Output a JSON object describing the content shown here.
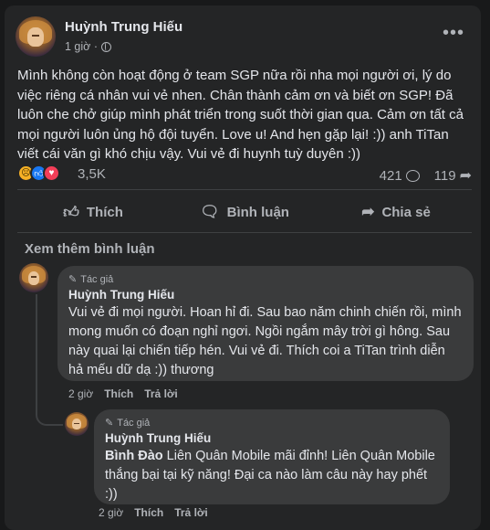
{
  "post": {
    "author": "Huỳnh Trung Hiếu",
    "time": "1 giờ ·",
    "more": "•••",
    "text": "Mình không còn hoạt động ở team SGP nữa rồi nha mọi người ơi, lý do việc riêng cá nhân vui vẻ nhen. Chân thành cảm ơn và biết ơn SGP! Đã luôn che chở giúp mình phát triển trong suốt thời gian qua. Cảm ơn tất cả mọi người luôn ủng hộ đội tuyển. Love u! And hẹn gặp lại! :)) anh TiTan viết cái văn gì khó chịu vậy. Vui vẻ đi huynh tuỳ duyên :))"
  },
  "reactions": {
    "icons": [
      "sad-emoji",
      "like",
      "love"
    ],
    "count": "3,5K",
    "comments": "421",
    "shares": "119"
  },
  "actions": {
    "like": "Thích",
    "comment": "Bình luận",
    "share": "Chia sẻ"
  },
  "see_more": "Xem thêm bình luận",
  "comments": [
    {
      "tag": "Tác giả",
      "name": "Huỳnh Trung Hiếu",
      "text": "Vui vẻ đi mọi người. Hoan hỉ đi. Sau bao năm chinh chiến rồi, mình mong muốn có đoạn nghỉ ngơi. Ngồi ngắm mây trời gì hông. Sau này quai lại chiến tiếp hén. Vui vẻ đi. Thích coi a TiTan trình diễn hả mếu dữ dạ :)) thương",
      "time": "2 giờ",
      "like": "Thích",
      "reply": "Trả lời"
    },
    {
      "tag": "Tác giả",
      "name": "Huỳnh Trung Hiếu",
      "mention": "Bình Đào",
      "text": " Liên Quân Mobile mãi đỉnh! Liên Quân Mobile thắng bại tại kỹ năng! Đại ca nào làm câu này hay phết :))",
      "time": "2 giờ",
      "like": "Thích",
      "reply": "Trả lời"
    }
  ],
  "colors": {
    "background": "#18191a",
    "card": "#242526",
    "bubble": "#3a3b3c",
    "text": "#e4e6eb",
    "muted": "#b0b3b8",
    "like_blue": "#1877f2",
    "love_red": "#f33e58",
    "sad_yellow": "#f7b125"
  }
}
